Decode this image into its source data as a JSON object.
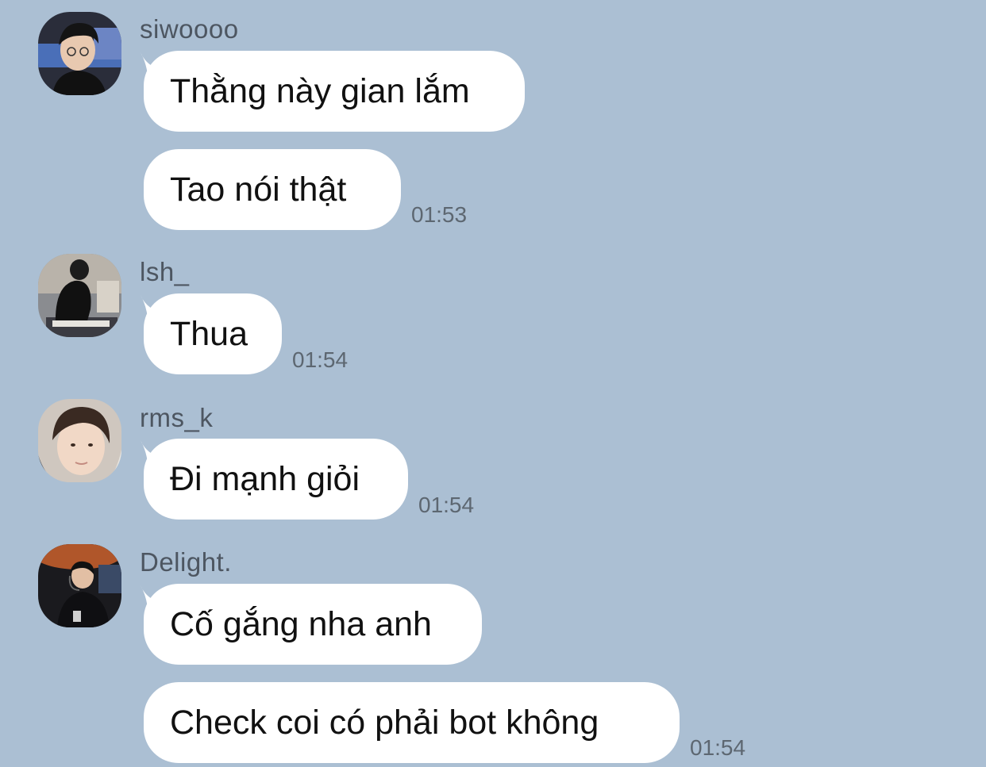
{
  "chat": {
    "groups": [
      {
        "sender": "siwoooo",
        "avatar_icon": "user-avatar-siwoooo",
        "messages": [
          {
            "text": "Thằng này gian lắm"
          },
          {
            "text": "Tao nói thật",
            "time": "01:53"
          }
        ]
      },
      {
        "sender": "lsh_",
        "avatar_icon": "user-avatar-lsh",
        "messages": [
          {
            "text": "Thua",
            "time": "01:54"
          }
        ]
      },
      {
        "sender": "rms_k",
        "avatar_icon": "user-avatar-rms-k",
        "messages": [
          {
            "text": "Đi mạnh giỏi",
            "time": "01:54"
          }
        ]
      },
      {
        "sender": "Delight.",
        "avatar_icon": "user-avatar-delight",
        "messages": [
          {
            "text": "Cố gắng nha anh"
          },
          {
            "text": "Check coi có phải bot không",
            "time": "01:54"
          }
        ]
      }
    ]
  },
  "colors": {
    "background": "#abbfd3",
    "bubble": "#ffffff",
    "sender_text": "#4d5661",
    "time_text": "#5d6771"
  }
}
